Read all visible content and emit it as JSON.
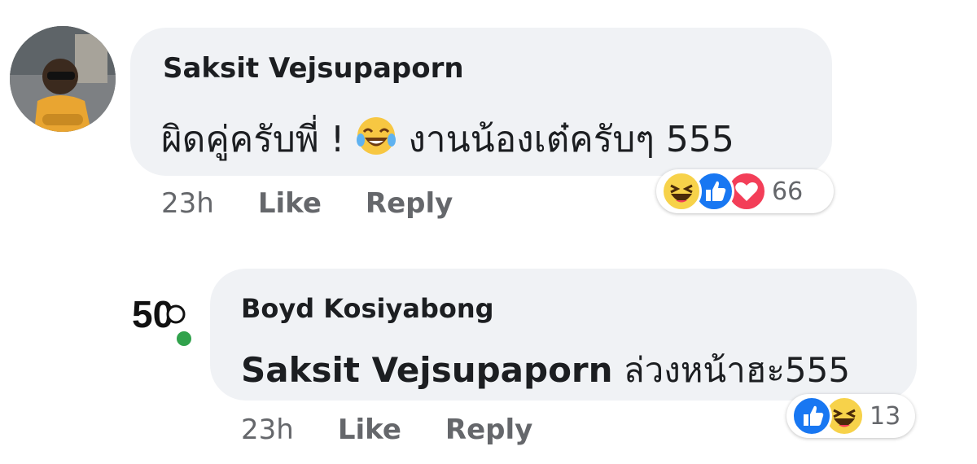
{
  "comments": [
    {
      "author": "Saksit Vejsupaporn",
      "text_before": "ผิดคู่ครับพี่ ! ",
      "text_after": " งานน้องเต๋ครับๆ 555",
      "inline_emoji": "laughing-tears-emoji",
      "time": "23h",
      "like_label": "Like",
      "reply_label": "Reply",
      "reactions": [
        "haha",
        "like",
        "love"
      ],
      "reaction_count": "66"
    },
    {
      "author": "Boyd Kosiyabong",
      "mention": "Saksit Vejsupaporn",
      "text": " ล่วงหน้าฮะ555",
      "avatar_text": "50",
      "online": true,
      "time": "23h",
      "like_label": "Like",
      "reply_label": "Reply",
      "reactions": [
        "like",
        "haha"
      ],
      "reaction_count": "13"
    }
  ],
  "colors": {
    "bubble": "#f0f2f5",
    "meta": "#65676b",
    "like_blue": "#1877f2",
    "love_red": "#f33e58",
    "haha_yellow": "#f7d24a",
    "online_green": "#31a24c"
  }
}
